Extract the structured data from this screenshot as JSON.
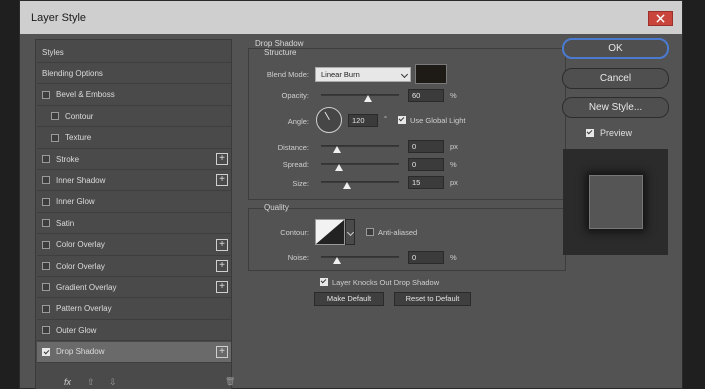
{
  "window": {
    "title": "Layer Style"
  },
  "left_panel": {
    "items": [
      {
        "label": "Styles",
        "checkbox": false,
        "checked": false,
        "plus": false,
        "indent": false,
        "selected": false
      },
      {
        "label": "Blending Options",
        "checkbox": false,
        "checked": false,
        "plus": false,
        "indent": false,
        "selected": false
      },
      {
        "label": "Bevel & Emboss",
        "checkbox": true,
        "checked": false,
        "plus": false,
        "indent": false,
        "selected": false
      },
      {
        "label": "Contour",
        "checkbox": true,
        "checked": false,
        "plus": false,
        "indent": true,
        "selected": false
      },
      {
        "label": "Texture",
        "checkbox": true,
        "checked": false,
        "plus": false,
        "indent": true,
        "selected": false
      },
      {
        "label": "Stroke",
        "checkbox": true,
        "checked": false,
        "plus": true,
        "indent": false,
        "selected": false
      },
      {
        "label": "Inner Shadow",
        "checkbox": true,
        "checked": false,
        "plus": true,
        "indent": false,
        "selected": false
      },
      {
        "label": "Inner Glow",
        "checkbox": true,
        "checked": false,
        "plus": false,
        "indent": false,
        "selected": false
      },
      {
        "label": "Satin",
        "checkbox": true,
        "checked": false,
        "plus": false,
        "indent": false,
        "selected": false
      },
      {
        "label": "Color Overlay",
        "checkbox": true,
        "checked": false,
        "plus": true,
        "indent": false,
        "selected": false
      },
      {
        "label": "Color Overlay",
        "checkbox": true,
        "checked": false,
        "plus": true,
        "indent": false,
        "selected": false
      },
      {
        "label": "Gradient Overlay",
        "checkbox": true,
        "checked": false,
        "plus": true,
        "indent": false,
        "selected": false
      },
      {
        "label": "Pattern Overlay",
        "checkbox": true,
        "checked": false,
        "plus": false,
        "indent": false,
        "selected": false
      },
      {
        "label": "Outer Glow",
        "checkbox": true,
        "checked": false,
        "plus": false,
        "indent": false,
        "selected": false
      },
      {
        "label": "Drop Shadow",
        "checkbox": true,
        "checked": true,
        "plus": true,
        "indent": false,
        "selected": true
      }
    ],
    "bottom_icons": {
      "fx": "fx",
      "up": "⇧",
      "down": "⇩",
      "trash": "🗑"
    }
  },
  "drop_shadow": {
    "title": "Drop Shadow",
    "structure": {
      "title": "Structure",
      "blend_mode_label": "Blend Mode:",
      "blend_mode_value": "Linear Burn",
      "shadow_color": "#1e1a16",
      "opacity_label": "Opacity:",
      "opacity_value": "60",
      "opacity_unit": "%",
      "opacity_level": 0.6,
      "angle_label": "Angle:",
      "angle_value": "120",
      "angle_unit": "°",
      "use_global_light_label": "Use Global Light",
      "use_global_light": true,
      "distance_label": "Distance:",
      "distance_value": "0",
      "distance_unit": "px",
      "spread_label": "Spread:",
      "spread_value": "0",
      "spread_unit": "%",
      "size_label": "Size:",
      "size_value": "15",
      "size_unit": "px"
    },
    "quality": {
      "title": "Quality",
      "contour_label": "Contour:",
      "anti_aliased_label": "Anti-aliased",
      "anti_aliased": false,
      "noise_label": "Noise:",
      "noise_value": "0",
      "noise_unit": "%"
    },
    "layer_knocks_out_label": "Layer Knocks Out Drop Shadow",
    "layer_knocks_out": true,
    "make_default_label": "Make Default",
    "reset_default_label": "Reset to Default"
  },
  "right_panel": {
    "ok_label": "OK",
    "cancel_label": "Cancel",
    "new_style_label": "New Style...",
    "preview_label": "Preview",
    "preview_checked": true
  },
  "colors": {
    "accent": "#4b7bd1",
    "close": "#c9443b"
  }
}
